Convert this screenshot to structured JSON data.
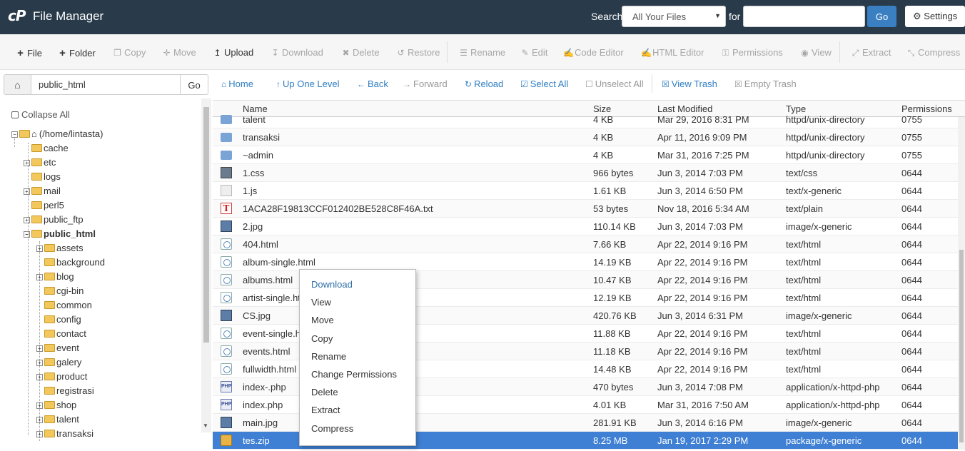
{
  "topbar": {
    "logo": "cP",
    "title": "File Manager",
    "search_label": "Search",
    "search_scope": "All Your Files",
    "for_label": "for",
    "search_value": "",
    "go_label": "Go",
    "settings_label": "Settings"
  },
  "toolbar": {
    "items": [
      {
        "label": "File",
        "icon": "plus-icon",
        "enabled": true
      },
      {
        "label": "Folder",
        "icon": "plus-icon",
        "enabled": true
      },
      {
        "label": "Copy",
        "icon": "copy-icon",
        "enabled": false
      },
      {
        "label": "Move",
        "icon": "move-icon",
        "enabled": false
      },
      {
        "label": "Upload",
        "icon": "upload-icon",
        "enabled": true
      },
      {
        "label": "Download",
        "icon": "download-icon",
        "enabled": false
      },
      {
        "label": "Delete",
        "icon": "delete-icon",
        "enabled": false
      },
      {
        "label": "Restore",
        "icon": "restore-icon",
        "enabled": false
      },
      {
        "label": "Rename",
        "icon": "rename-icon",
        "enabled": false
      },
      {
        "label": "Edit",
        "icon": "pencil-icon",
        "enabled": false
      },
      {
        "label": "Code Editor",
        "icon": "code-editor-icon",
        "enabled": false
      },
      {
        "label": "HTML Editor",
        "icon": "html-editor-icon",
        "enabled": false
      },
      {
        "label": "Permissions",
        "icon": "key-icon",
        "enabled": false
      },
      {
        "label": "View",
        "icon": "eye-icon",
        "enabled": false
      },
      {
        "label": "Extract",
        "icon": "extract-icon",
        "enabled": false
      },
      {
        "label": "Compress",
        "icon": "compress-icon",
        "enabled": false
      }
    ]
  },
  "pathbar": {
    "path": "public_html",
    "go_label": "Go",
    "nav": [
      {
        "label": "Home",
        "icon": "home-icon",
        "enabled": true
      },
      {
        "label": "Up One Level",
        "icon": "arrow-up-icon",
        "enabled": true
      },
      {
        "label": "Back",
        "icon": "arrow-left-icon",
        "enabled": true
      },
      {
        "label": "Forward",
        "icon": "arrow-right-icon",
        "enabled": false
      },
      {
        "label": "Reload",
        "icon": "reload-icon",
        "enabled": true
      },
      {
        "label": "Select All",
        "icon": "check-square-icon",
        "enabled": true
      },
      {
        "label": "Unselect All",
        "icon": "square-icon",
        "enabled": false
      },
      {
        "label": "View Trash",
        "icon": "trash-icon",
        "enabled": true
      },
      {
        "label": "Empty Trash",
        "icon": "trash-icon",
        "enabled": false
      }
    ]
  },
  "sidebar": {
    "collapse_all": "Collapse All",
    "root": "(/home/lintasta)",
    "items": [
      {
        "label": "cache",
        "expandable": false,
        "level": 1
      },
      {
        "label": "etc",
        "expandable": true,
        "level": 1
      },
      {
        "label": "logs",
        "expandable": false,
        "level": 1
      },
      {
        "label": "mail",
        "expandable": true,
        "level": 1
      },
      {
        "label": "perl5",
        "expandable": false,
        "level": 1
      },
      {
        "label": "public_ftp",
        "expandable": true,
        "level": 1
      },
      {
        "label": "public_html",
        "expandable": true,
        "level": 1,
        "current": true
      },
      {
        "label": "assets",
        "expandable": true,
        "level": 2
      },
      {
        "label": "background",
        "expandable": false,
        "level": 2
      },
      {
        "label": "blog",
        "expandable": true,
        "level": 2
      },
      {
        "label": "cgi-bin",
        "expandable": false,
        "level": 2
      },
      {
        "label": "common",
        "expandable": false,
        "level": 2
      },
      {
        "label": "config",
        "expandable": false,
        "level": 2
      },
      {
        "label": "contact",
        "expandable": false,
        "level": 2
      },
      {
        "label": "event",
        "expandable": true,
        "level": 2
      },
      {
        "label": "galery",
        "expandable": true,
        "level": 2
      },
      {
        "label": "product",
        "expandable": true,
        "level": 2
      },
      {
        "label": "registrasi",
        "expandable": false,
        "level": 2
      },
      {
        "label": "shop",
        "expandable": true,
        "level": 2
      },
      {
        "label": "talent",
        "expandable": true,
        "level": 2
      },
      {
        "label": "transaksi",
        "expandable": true,
        "level": 2
      }
    ]
  },
  "table": {
    "columns": [
      "Name",
      "Size",
      "Last Modified",
      "Type",
      "Permissions"
    ],
    "rows": [
      {
        "icon": "dir",
        "name": "talent",
        "size": "4 KB",
        "modified": "Mar 29, 2016 8:31 PM",
        "type": "httpd/unix-directory",
        "perms": "0755"
      },
      {
        "icon": "dir",
        "name": "transaksi",
        "size": "4 KB",
        "modified": "Apr 11, 2016 9:09 PM",
        "type": "httpd/unix-directory",
        "perms": "0755"
      },
      {
        "icon": "dir",
        "name": "~admin",
        "size": "4 KB",
        "modified": "Mar 31, 2016 7:25 PM",
        "type": "httpd/unix-directory",
        "perms": "0755"
      },
      {
        "icon": "css",
        "name": "1.css",
        "size": "966 bytes",
        "modified": "Jun 3, 2014 7:03 PM",
        "type": "text/css",
        "perms": "0644"
      },
      {
        "icon": "gen",
        "name": "1.js",
        "size": "1.61 KB",
        "modified": "Jun 3, 2014 6:50 PM",
        "type": "text/x-generic",
        "perms": "0644"
      },
      {
        "icon": "txt",
        "name": "1ACA28F19813CCF012402BE528C8F46A.txt",
        "size": "53 bytes",
        "modified": "Nov 18, 2016 5:34 AM",
        "type": "text/plain",
        "perms": "0644"
      },
      {
        "icon": "img",
        "name": "2.jpg",
        "size": "110.14 KB",
        "modified": "Jun 3, 2014 7:03 PM",
        "type": "image/x-generic",
        "perms": "0644"
      },
      {
        "icon": "html",
        "name": "404.html",
        "size": "7.66 KB",
        "modified": "Apr 22, 2014 9:16 PM",
        "type": "text/html",
        "perms": "0644"
      },
      {
        "icon": "html",
        "name": "album-single.html",
        "size": "14.19 KB",
        "modified": "Apr 22, 2014 9:16 PM",
        "type": "text/html",
        "perms": "0644"
      },
      {
        "icon": "html",
        "name": "albums.html",
        "size": "10.47 KB",
        "modified": "Apr 22, 2014 9:16 PM",
        "type": "text/html",
        "perms": "0644"
      },
      {
        "icon": "html",
        "name": "artist-single.ht",
        "size": "12.19 KB",
        "modified": "Apr 22, 2014 9:16 PM",
        "type": "text/html",
        "perms": "0644"
      },
      {
        "icon": "img",
        "name": "CS.jpg",
        "size": "420.76 KB",
        "modified": "Jun 3, 2014 6:31 PM",
        "type": "image/x-generic",
        "perms": "0644"
      },
      {
        "icon": "html",
        "name": "event-single.h",
        "size": "11.88 KB",
        "modified": "Apr 22, 2014 9:16 PM",
        "type": "text/html",
        "perms": "0644"
      },
      {
        "icon": "html",
        "name": "events.html",
        "size": "11.18 KB",
        "modified": "Apr 22, 2014 9:16 PM",
        "type": "text/html",
        "perms": "0644"
      },
      {
        "icon": "html",
        "name": "fullwidth.html",
        "size": "14.48 KB",
        "modified": "Apr 22, 2014 9:16 PM",
        "type": "text/html",
        "perms": "0644"
      },
      {
        "icon": "php",
        "name": "index-.php",
        "size": "470 bytes",
        "modified": "Jun 3, 2014 7:08 PM",
        "type": "application/x-httpd-php",
        "perms": "0644"
      },
      {
        "icon": "php",
        "name": "index.php",
        "size": "4.01 KB",
        "modified": "Mar 31, 2016 7:50 AM",
        "type": "application/x-httpd-php",
        "perms": "0644"
      },
      {
        "icon": "img",
        "name": "main.jpg",
        "size": "281.91 KB",
        "modified": "Jun 3, 2014 6:16 PM",
        "type": "image/x-generic",
        "perms": "0644"
      },
      {
        "icon": "zip",
        "name": "tes.zip",
        "size": "8.25 MB",
        "modified": "Jan 19, 2017 2:29 PM",
        "type": "package/x-generic",
        "perms": "0644",
        "selected": true
      }
    ]
  },
  "context_menu": {
    "items": [
      "Download",
      "View",
      "Move",
      "Copy",
      "Rename",
      "Change Permissions",
      "Delete",
      "Extract",
      "Compress"
    ]
  },
  "colors": {
    "topbar": "#293a4a",
    "accent": "#3a7fc1",
    "selected_row": "#3f80d4",
    "link": "#2f7ec1"
  }
}
